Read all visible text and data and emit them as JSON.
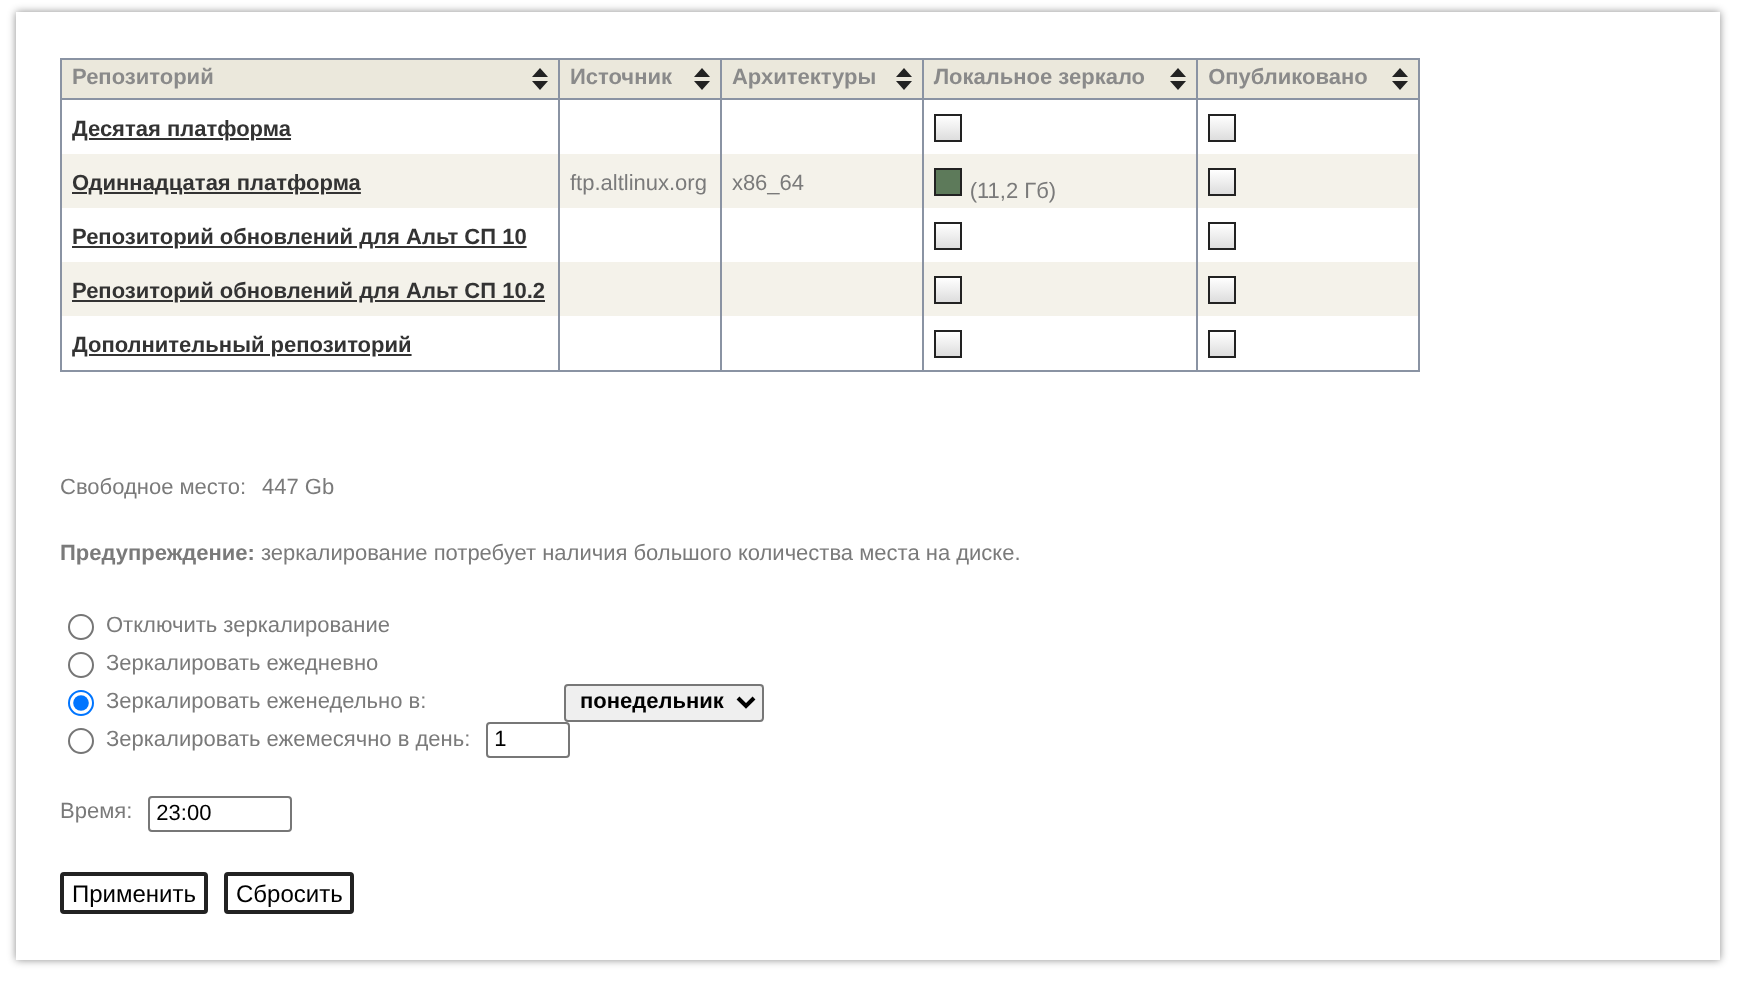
{
  "table": {
    "columns": [
      {
        "label": "Репозиторий"
      },
      {
        "label": "Источник"
      },
      {
        "label": "Архитектуры"
      },
      {
        "label": "Локальное зеркало"
      },
      {
        "label": "Опубликовано"
      }
    ],
    "rows": [
      {
        "name": "Десятая платформа",
        "mirror": false,
        "published": false
      },
      {
        "name": "Одиннадцатая платформа",
        "source": "ftp.altlinux.org",
        "arch": "x86_64",
        "mirror": true,
        "mirror_size": "(11,2 Гб)",
        "published": false
      },
      {
        "name": "Репозиторий обновлений для Альт СП 10",
        "mirror": false,
        "published": false
      },
      {
        "name": "Репозиторий обновлений для Альт СП 10.2",
        "mirror": false,
        "published": false
      },
      {
        "name": "Дополнительный репозиторий",
        "mirror": false,
        "published": false
      }
    ]
  },
  "free_space": {
    "label": "Свободное место:",
    "value": "447 Gb"
  },
  "warning": "**Предупреждение:** зеркалирование потребует наличия большого количества места на диске.",
  "schedule": [
    {
      "kind": "plain",
      "label": "Отключить зеркалирование",
      "selected": false
    },
    {
      "kind": "plain",
      "label": "Зеркалировать ежедневно",
      "selected": false
    },
    {
      "kind": "select",
      "label": "Зеркалировать еженедельно в:",
      "selected": true,
      "value": "понедельник"
    },
    {
      "kind": "number",
      "label": "Зеркалировать ежемесячно в день:",
      "selected": false,
      "value": "1"
    }
  ],
  "time": {
    "label": "Время:",
    "value": "23:00"
  },
  "buttons": [
    "Применить",
    "Сбросить"
  ]
}
